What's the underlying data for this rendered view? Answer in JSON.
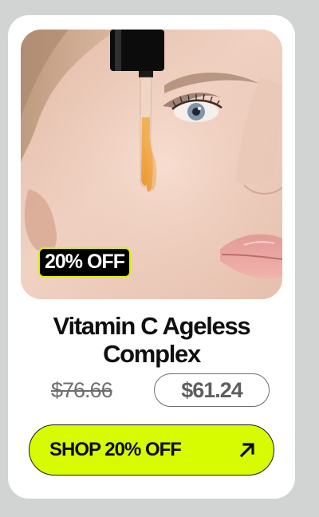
{
  "product": {
    "discount_badge": "20% OFF",
    "title": "Vitamin C Ageless Complex",
    "original_price": "$76.66",
    "sale_price": "$61.24",
    "cta_label": "SHOP 20% OFF",
    "image_description": "Close-up of a woman applying vitamin C serum from a dropper to her cheek"
  },
  "icons": {
    "cta_icon": "arrow-up-right-icon"
  },
  "colors": {
    "page_background": "#d2d3d3",
    "card_background": "#ffffff",
    "cta_background": "#d7fb00",
    "badge_background": "#000000",
    "badge_border": "#e0f000",
    "serum": "#f0a43a"
  }
}
